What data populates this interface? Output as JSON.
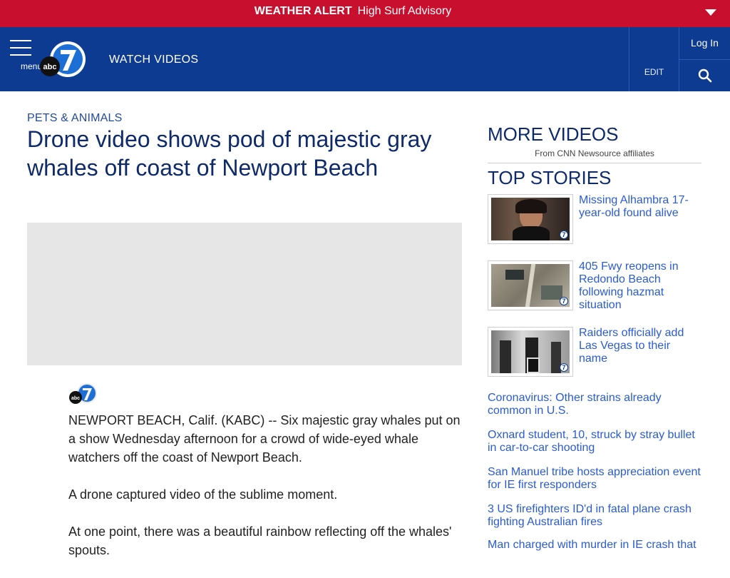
{
  "alert": {
    "label": "WEATHER ALERT",
    "text": "High Surf Advisory",
    "chevron_icon": "chevron-down-icon"
  },
  "header": {
    "menu_label": "menu",
    "logo_icon": "abc7-logo",
    "watch_videos": "WATCH VIDEOS",
    "edit": "EDIT",
    "login": "Log In",
    "search_icon": "search-icon"
  },
  "article": {
    "category": "PETS & ANIMALS",
    "headline": "Drone video shows pod of majestic gray whales off coast of Newport Beach",
    "byline_icon": "abc7-logo",
    "paragraphs": [
      "NEWPORT BEACH, Calif. (KABC) -- Six majestic gray whales put on a show Wednesday afternoon for a crowd of wide-eyed whale watchers off the coast of Newport Beach.",
      "A drone captured video of the sublime moment.",
      "At one point, there was a beautiful rainbow reflecting off the whales' spouts."
    ]
  },
  "sidebar": {
    "more_videos_title": "MORE VIDEOS",
    "more_videos_source": "From CNN Newsource affiliates",
    "top_stories_title": "TOP STORIES",
    "thumb_stories": [
      {
        "title": "Missing Alhambra 17-year-old found alive",
        "badge": "7"
      },
      {
        "title": "405 Fwy reopens in Redondo Beach following hazmat situation",
        "badge": "7"
      },
      {
        "title": "Raiders officially add Las Vegas to their name",
        "badge": "7"
      }
    ],
    "text_stories": [
      "Coronavirus: Other strains already common in U.S.",
      "Oxnard student, 10, struck by stray bullet in car-to-car shooting",
      "San Manuel tribe hosts appreciation event for IE first responders",
      "3 US firefighters ID'd in fatal plane crash fighting Australian fires",
      "Man charged with murder in IE crash that"
    ]
  },
  "colors": {
    "alert_red": "#c8102e",
    "header_blue": "#0d3b91",
    "link_blue": "#2a5bd7",
    "headline_navy": "#0e2a6b"
  }
}
